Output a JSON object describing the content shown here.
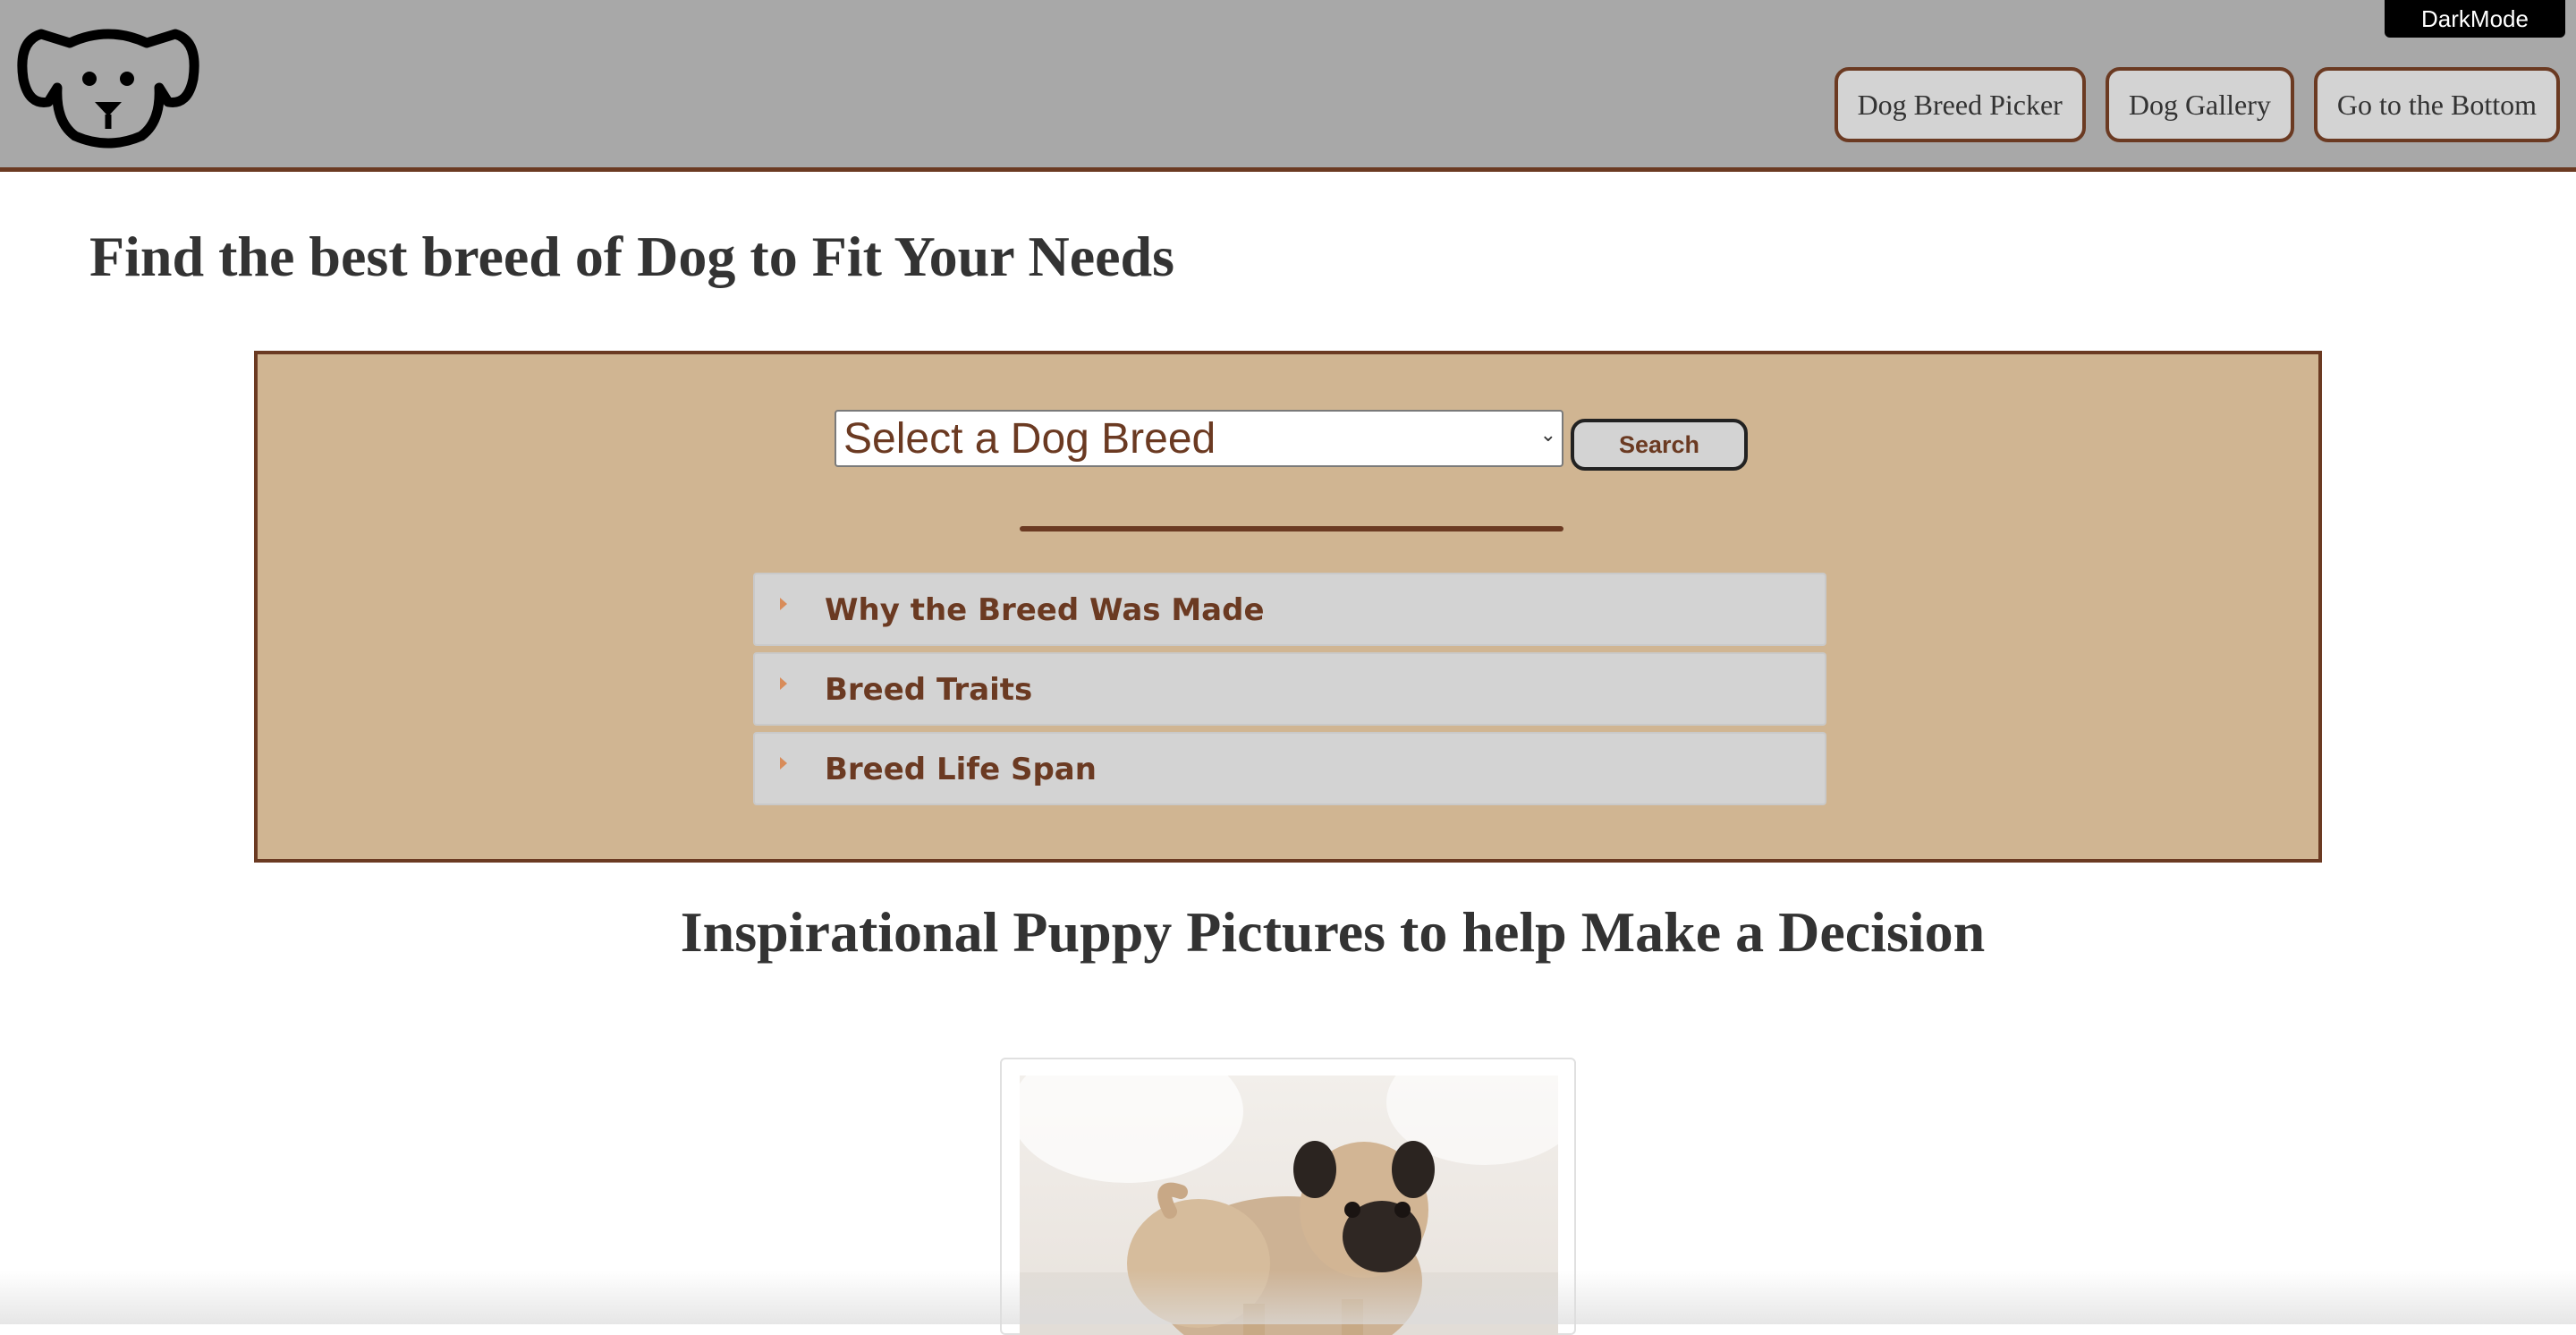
{
  "header": {
    "logo_icon": "dog-face-icon",
    "darkmode_label": "DarkMode",
    "nav": [
      {
        "label": "Dog Breed Picker"
      },
      {
        "label": "Dog Gallery"
      },
      {
        "label": "Go to the Bottom"
      }
    ]
  },
  "main": {
    "title": "Find the best breed of Dog to Fit Your Needs",
    "picker": {
      "select_value": "Select a Dog Breed",
      "search_label": "Search",
      "sections": [
        {
          "label": "Why the Breed Was Made"
        },
        {
          "label": "Breed Traits"
        },
        {
          "label": "Breed Life Span"
        }
      ]
    },
    "gallery_title": "Inspirational Puppy Pictures to help Make a Decision",
    "gallery_image": "pug-puppy-photo"
  },
  "colors": {
    "header_bg": "#a8a8a8",
    "accent_brown": "#6b3a22",
    "panel_tan": "#d0b592",
    "button_gray": "#d3d3d3"
  }
}
